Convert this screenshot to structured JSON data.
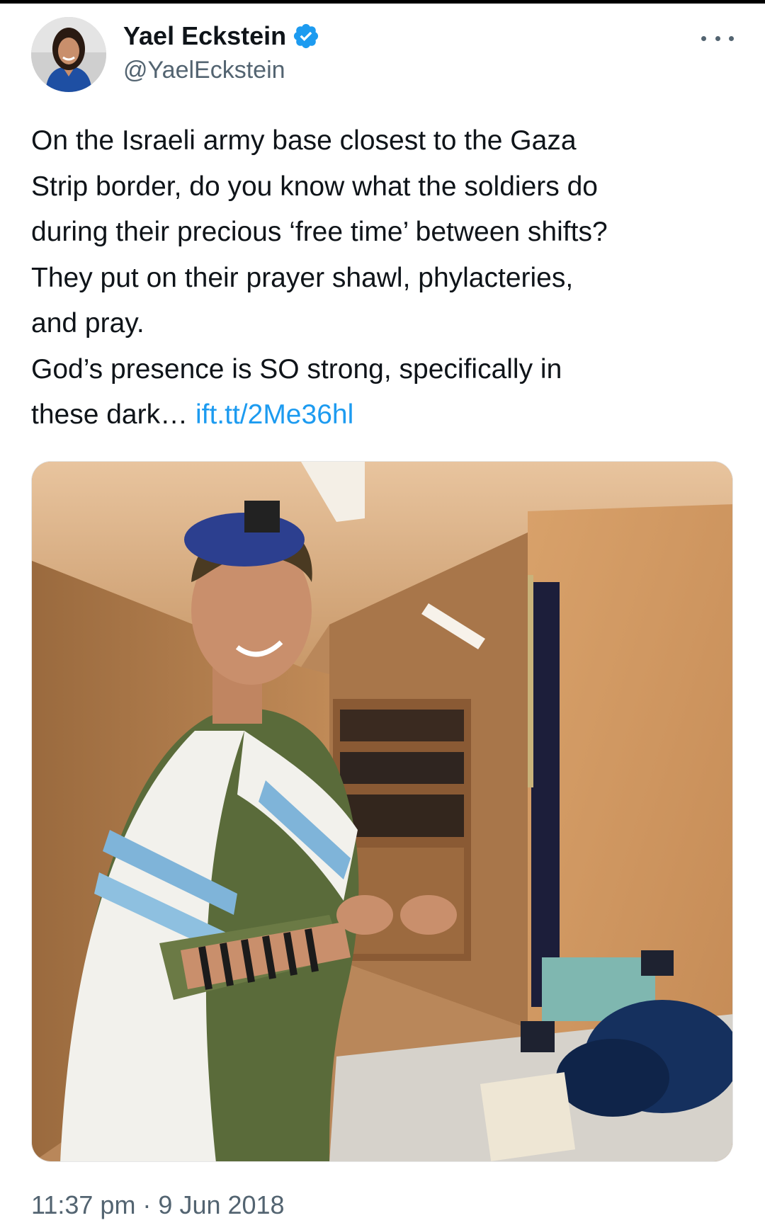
{
  "author": {
    "display_name": "Yael Eckstein",
    "handle": "@YaelEckstein",
    "verified": true,
    "avatar_icon": "profile-photo"
  },
  "tweet": {
    "lines": [
      "On the Israeli army base closest to the Gaza",
      "Strip border, do you know what the soldiers do",
      "during their precious ‘free time’ between shifts?",
      "They put on their prayer shawl, phylacteries,",
      "and pray.",
      "God’s presence is SO strong, specifically in",
      "these dark…"
    ],
    "link_text": "ift.tt/2Me36hl",
    "timestamp": "11:37 pm · 9 Jun 2018"
  },
  "media": {
    "description_icon": "photo-soldier-praying"
  },
  "colors": {
    "text": "#0f1419",
    "secondary": "#536471",
    "link": "#1d9bf0",
    "verified": "#1d9bf0"
  },
  "icons": {
    "more": "more-options-icon",
    "verified": "verified-badge-icon"
  }
}
